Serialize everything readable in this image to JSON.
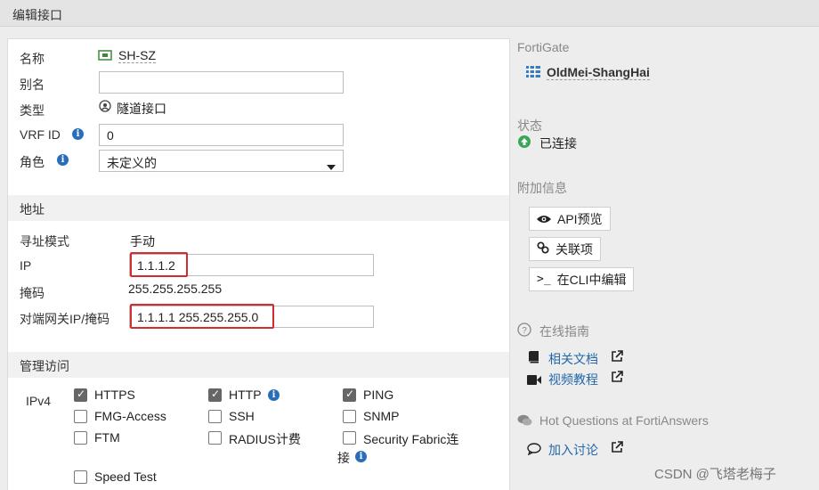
{
  "window": {
    "title": "编辑接口"
  },
  "form": {
    "name_label": "名称",
    "name_value": "SH-SZ",
    "alias_label": "别名",
    "alias_value": "",
    "type_label": "类型",
    "type_value": "隧道接口",
    "vrf_label": "VRF ID",
    "vrf_value": "0",
    "role_label": "角色",
    "role_value": "未定义的"
  },
  "address": {
    "section_title": "地址",
    "mode_label": "寻址模式",
    "mode_value": "手动",
    "ip_label": "IP",
    "ip_value": "1.1.1.2",
    "mask_label": "掩码",
    "mask_value": "255.255.255.255",
    "peer_label": "对端网关IP/掩码",
    "peer_value": "1.1.1.1 255.255.255.0"
  },
  "access": {
    "section_title": "管理访问",
    "ipv4_label": "IPv4",
    "options": [
      {
        "label": "HTTPS",
        "checked": true
      },
      {
        "label": "HTTP",
        "checked": true
      },
      {
        "label": "PING",
        "checked": true
      },
      {
        "label": "FMG-Access",
        "checked": false
      },
      {
        "label": "SSH",
        "checked": false
      },
      {
        "label": "SNMP",
        "checked": false
      },
      {
        "label": "FTM",
        "checked": false
      },
      {
        "label": "RADIUS计费",
        "checked": false
      },
      {
        "label": "Security Fabric连",
        "checked": false
      },
      {
        "label": "Speed Test",
        "checked": false
      }
    ],
    "fabric_wrap": "接"
  },
  "sidebar": {
    "fortigate_label": "FortiGate",
    "device_name": "OldMei-ShangHai",
    "status_label": "状态",
    "status_value": "已连接",
    "extra_label": "附加信息",
    "api_button": "API预览",
    "refs_button": "关联项",
    "cli_button": "在CLI中编辑",
    "guide_label": "在线指南",
    "docs_link": "相关文档",
    "video_link": "视频教程",
    "hotq_label": "Hot Questions at FortiAnswers",
    "join_link": "加入讨论"
  },
  "watermark": "CSDN @飞塔老梅子",
  "colors": {
    "highlight": "#d42c2c",
    "link": "#2467aa",
    "status_ok": "#3aa757"
  }
}
